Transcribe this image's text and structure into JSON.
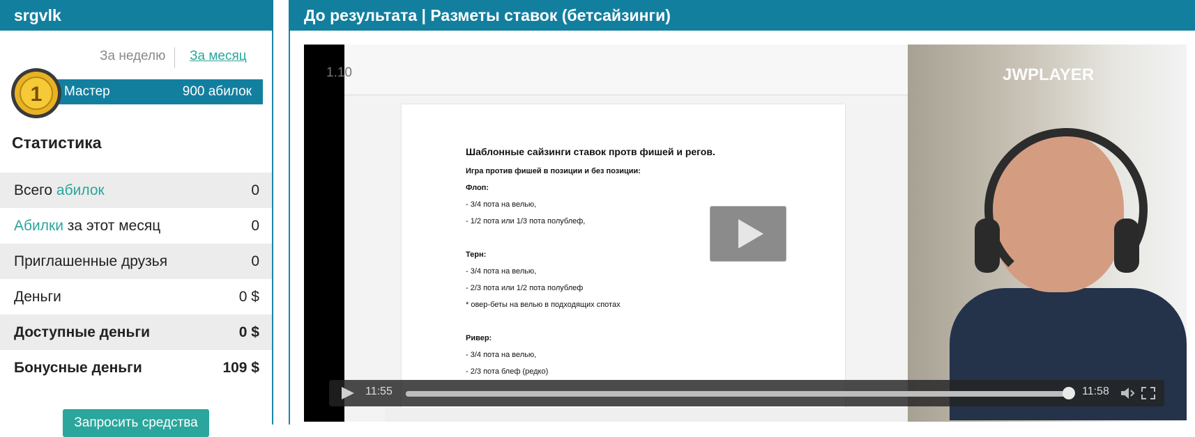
{
  "left": {
    "username": "srgvlk",
    "period": {
      "week": "За неделю",
      "month": "За месяц"
    },
    "level": {
      "title": "Мастер",
      "points": "900 абилок",
      "badge": "1"
    },
    "stats_title": "Статистика",
    "stats": [
      {
        "label": "Всего",
        "label_accent": "абилок",
        "value": "0"
      },
      {
        "label_accent": "Абилки",
        "label": "за этот месяц",
        "value": "0"
      },
      {
        "label": "Приглашенные друзья",
        "value": "0"
      },
      {
        "label": "Деньги",
        "value": "0 $"
      },
      {
        "label": "Доступные деньги",
        "value": "0 $"
      },
      {
        "label": "Бонусные деньги",
        "value": "109 $"
      }
    ],
    "request_button": "Запросить средства"
  },
  "right": {
    "header": "До результата | Разметы ставок (бетсайзинги)"
  },
  "video": {
    "speed": "1.10",
    "brand": "JWPLAYER",
    "current_time": "11:55",
    "duration": "11:58",
    "progress": 0.996,
    "doc": {
      "title": "Шаблонные сайзинги ставок протв фишей и регов.",
      "lines": [
        "Игра против фишей в позиции и без позиции:",
        "Флоп:",
        "- 3/4 пота на велью,",
        "- 1/2 пота или 1/3 пота полублеф,",
        "Терн:",
        "- 3/4 пота на велью,",
        "- 2/3 пота или 1/2 пота полублеф",
        "* овер-беты на велью в подходящих спотах",
        "Ривер:",
        "- 3/4 пота на велью,",
        "- 2/3 пота блеф (редко)"
      ]
    }
  },
  "colors": {
    "header": "#137f9f",
    "accent": "#2aa69c",
    "shaded_row": "#ececec"
  }
}
